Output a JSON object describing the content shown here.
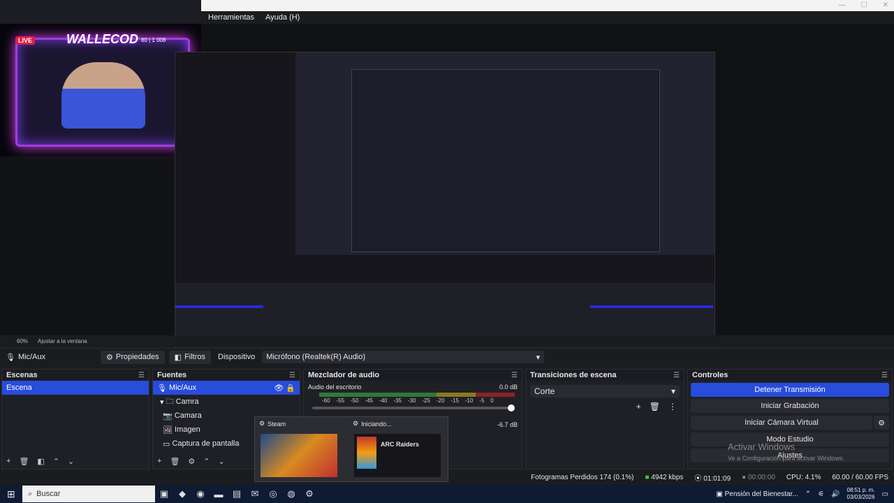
{
  "window": {
    "menu": [
      "Herramientas",
      "Ayuda (H)"
    ]
  },
  "webcam": {
    "live_badge": "LIVE",
    "logo_text": "WALLECOD",
    "stats": "80 | 1 008"
  },
  "preview_toolbar": {
    "zoom": "60%",
    "fit_label": "Ajustar a la ventana"
  },
  "source_bar": {
    "source_name": "Mic/Aux",
    "properties_label": "Propiedades",
    "filters_label": "Filtros",
    "device_label": "Dispositivo",
    "device_value": "Micrófono (Realtek(R) Audio)"
  },
  "scenes": {
    "title": "Escenas",
    "items": [
      "Escena"
    ]
  },
  "sources": {
    "title": "Fuentes",
    "items": [
      "Mic/Aux",
      "Camra",
      "Camara",
      "Imagen",
      "Captura de pantalla"
    ]
  },
  "mixer": {
    "title": "Mezclador de audio",
    "track1_name": "Audio del escritorio",
    "track1_level": "0.0 dB",
    "track2_level": "-6.7 dB",
    "scale": [
      "-60",
      "-55",
      "-50",
      "-45",
      "-40",
      "-35",
      "-30",
      "-25",
      "-20",
      "-15",
      "-10",
      "-5",
      "0"
    ]
  },
  "transitions": {
    "title": "Transiciones de escena",
    "selected": "Corte"
  },
  "controls": {
    "title": "Controles",
    "stop_stream": "Detener Transmisión",
    "start_recording": "Iniciar Grabación",
    "start_virtual_cam": "Iniciar Cámara Virtual",
    "studio_mode": "Modo Estudio",
    "settings": "Ajustes"
  },
  "watermark": {
    "line1": "Activar Windows",
    "line2": "Ve a Configuración para activar Windows."
  },
  "status": {
    "dropped_frames": "Fotogramas Perdidos 174 (0.1%)",
    "bitrate": "4942 kbps",
    "stream_time": "01:01:09",
    "rec_time": "00:00:00",
    "cpu": "CPU: 4.1%",
    "fps": "60.00 / 60.00 FPS"
  },
  "popup": {
    "left_title": "Steam",
    "right_title": "Iniciando...",
    "game_label": "ARC Raiders"
  },
  "taskbar": {
    "search_placeholder": "Buscar",
    "tray_app": "Pensión del Bienestar...",
    "time": "08:51 p. m.",
    "date": "03/03/2026"
  }
}
